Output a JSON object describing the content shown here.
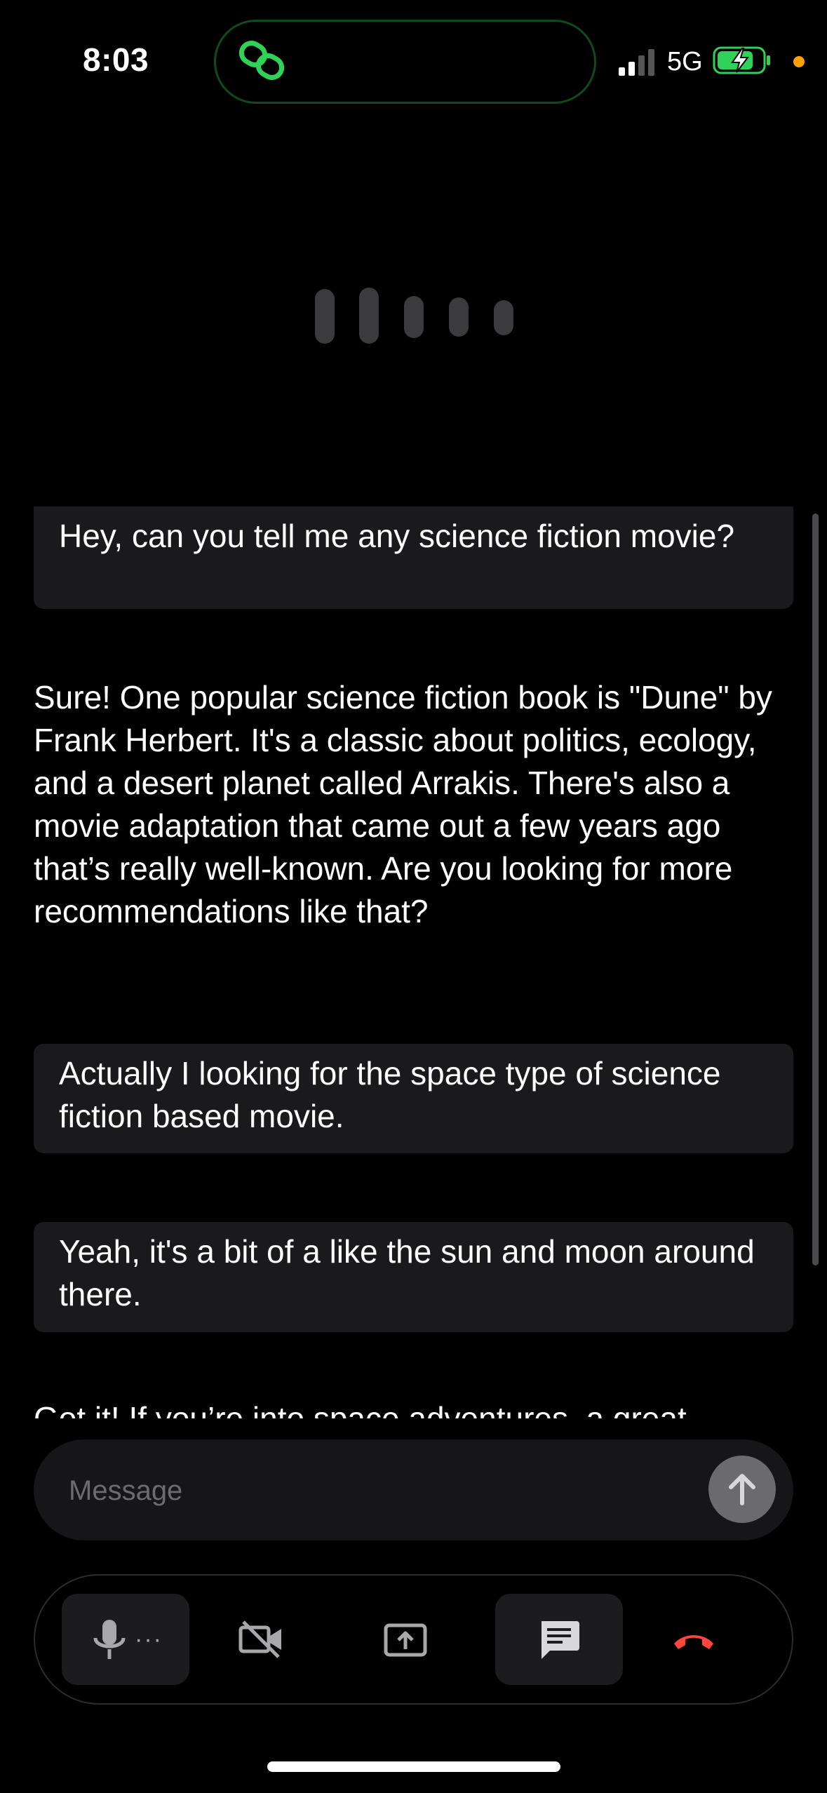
{
  "status": {
    "time": "8:03",
    "network": "5G",
    "colors": {
      "island_icon": "#30d158",
      "battery": "#30d158",
      "privacy_dot": "#ff9f0a"
    }
  },
  "conversation": {
    "messages": [
      {
        "role": "user",
        "text": "Hey, can you tell me any science fiction movie?"
      },
      {
        "role": "assistant",
        "text": "Sure! One popular science fiction book is \"Dune\" by Frank Herbert. It's a classic about politics, ecology, and a desert planet called Arrakis. There's also a movie adaptation that came out a few years ago that’s really well-known. Are you looking for more recommendations like that?"
      },
      {
        "role": "user",
        "text": "Actually I looking for the space type of science fiction based movie."
      },
      {
        "role": "user",
        "text": "Yeah, it's a bit of a like the sun and moon around there."
      },
      {
        "role": "assistant",
        "text": "Got it! If you’re into space adventures, a great"
      }
    ]
  },
  "composer": {
    "placeholder": "Message"
  },
  "controls": {
    "mic_more": "···",
    "items": [
      "microphone-icon",
      "video-off-icon",
      "screen-share-icon",
      "chat-icon",
      "end-call-icon"
    ],
    "end_call_color": "#ff453a"
  }
}
